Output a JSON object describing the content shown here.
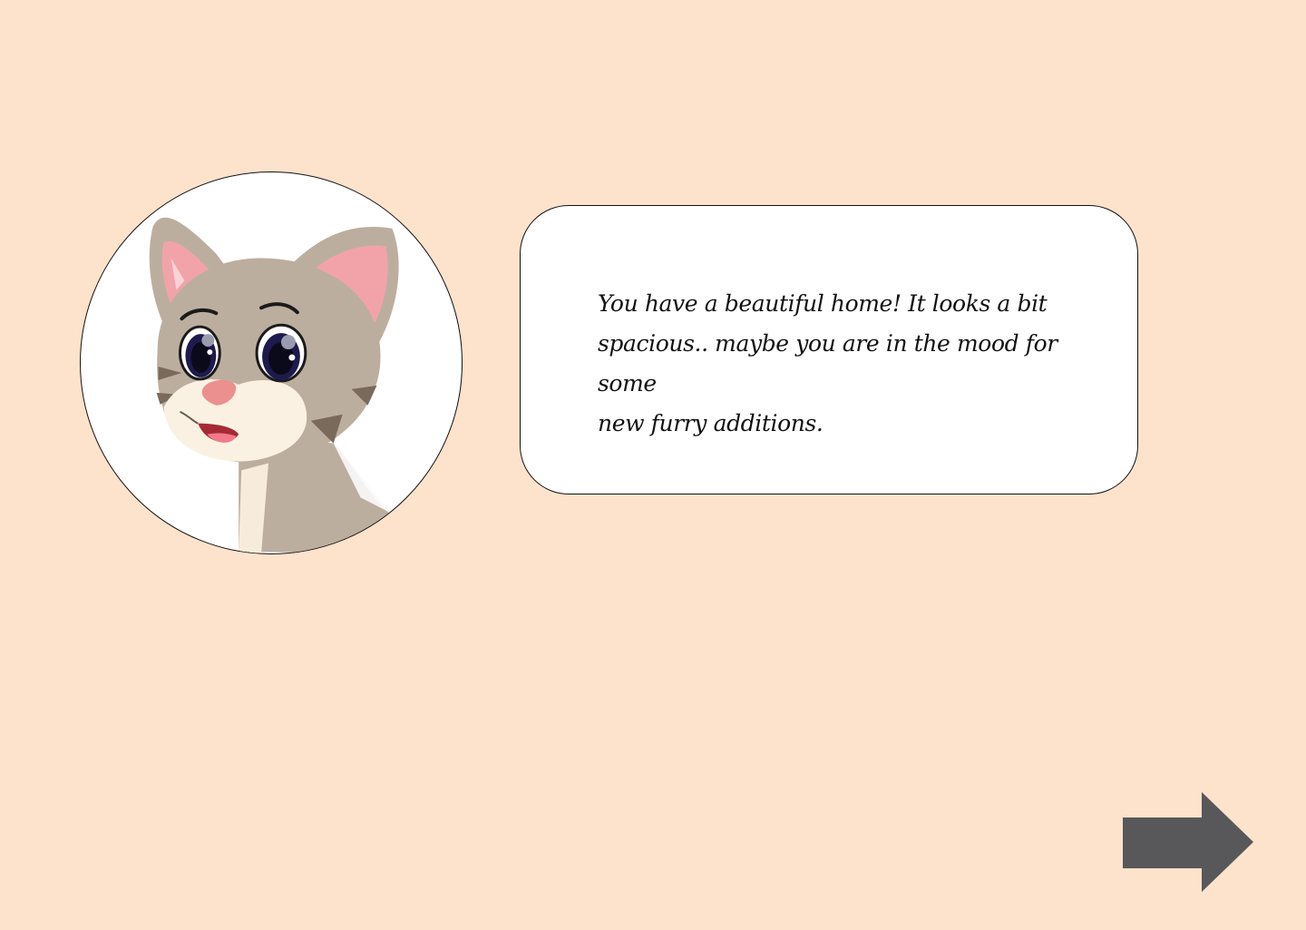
{
  "dialog": {
    "text": "You have a beautiful home! It looks a bit\n spacious.. maybe you are in the mood for some\nnew furry additions."
  },
  "character": {
    "icon": "cat-character-icon"
  },
  "navigation": {
    "next_icon": "right-arrow-icon"
  },
  "colors": {
    "background": "#fde2cc",
    "bubble": "#ffffff",
    "arrow": "#58585a",
    "cat_fur": "#bcae9f",
    "cat_stripe": "#7a6a5c",
    "cat_ear_inner": "#f2a3aa",
    "cat_muzzle": "#fbf1e2"
  }
}
